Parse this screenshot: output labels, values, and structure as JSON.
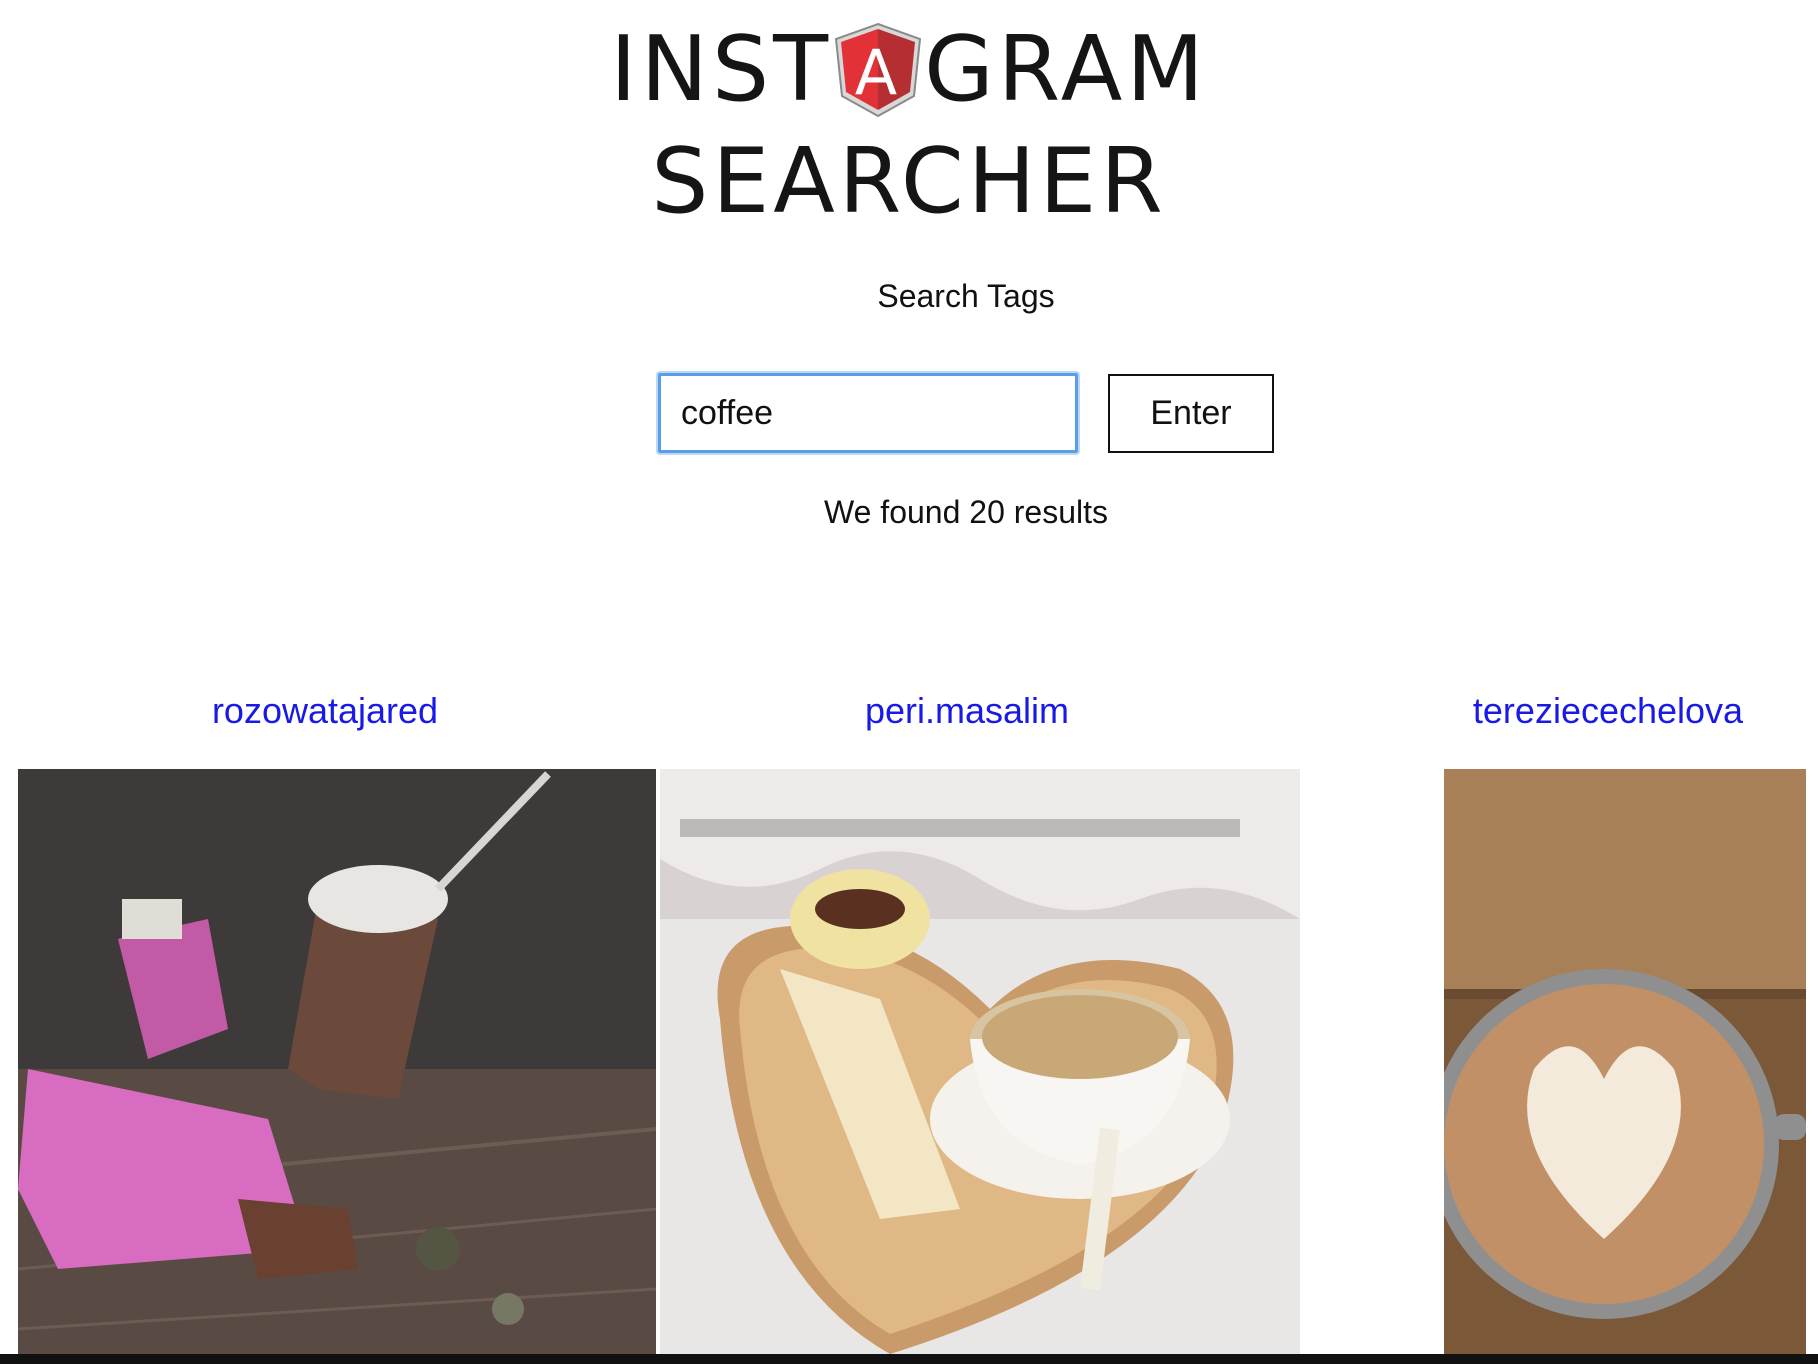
{
  "logo": {
    "line1_before": "INST",
    "line1_shield_letter": "A",
    "line1_after": "GRAM",
    "line2": "SEARCHER",
    "shield_colors": {
      "left": "#e23237",
      "right": "#b52e31",
      "letter": "#ffffff",
      "border": "#8a8a8a"
    }
  },
  "search": {
    "label": "Search Tags",
    "value": "coffee",
    "button_label": "Enter",
    "focus_color": "#5a9ee8"
  },
  "results": {
    "summary": "We found 20 results",
    "link_color": "#1a1ae6",
    "items": [
      {
        "username": "rozowatajared",
        "image": "drinks-and-chocolate-photo"
      },
      {
        "username": "peri.masalim",
        "image": "coffee-on-heart-tray-photo"
      },
      {
        "username": "tereziecechelova",
        "image": "latte-art-heart-photo"
      }
    ]
  }
}
